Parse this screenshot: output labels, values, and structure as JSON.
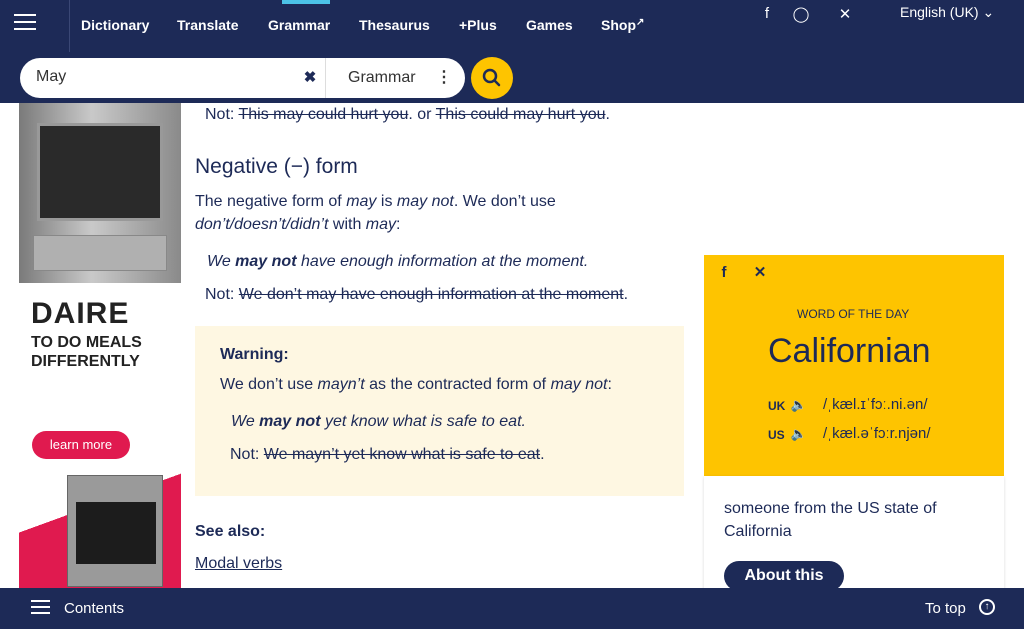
{
  "nav": {
    "items": [
      "Dictionary",
      "Translate",
      "Grammar",
      "Thesaurus",
      "+Plus",
      "Games",
      "Shop"
    ],
    "language": "English (UK)"
  },
  "icons": {
    "menu": "hamburger-menu-icon",
    "shop_external": "external-link-icon",
    "social_top": [
      "facebook-icon",
      "instagram-icon",
      "x-icon"
    ],
    "chevron": "chevron-down-icon",
    "search": "search-icon",
    "clear": "close-icon",
    "options": "vertical-dots-icon",
    "audio": "speaker-icon",
    "to_top": "arrow-up-circle-icon"
  },
  "search": {
    "value": "May",
    "scope": "Grammar"
  },
  "ad": {
    "brand": "DAIRE",
    "tagline": "TO DO MEALS DIFFERENTLY",
    "cta": "learn more"
  },
  "article": {
    "not1_prefix": "Not:",
    "not1_a": "This may could hurt you",
    "not1_mid": ". or",
    "not1_b": "This could may hurt you",
    "not1_end": ".",
    "heading": "Negative (−) form",
    "para1_a": "The negative form of",
    "para1_b": "may",
    "para1_c": "is",
    "para1_d": "may not",
    "para1_e": ". We don’t use",
    "para1_f": "don’t/doesn’t/didn’t",
    "para1_g": "with",
    "para1_h": "may",
    "para1_i": ":",
    "ex1_a": "We",
    "ex1_b": "may not",
    "ex1_c": "have enough information at the moment.",
    "not2_prefix": "Not:",
    "not2_struck": "We don’t may have enough information at the moment",
    "not2_end": ".",
    "warning_title": "Warning:",
    "warning_a": "We don’t use",
    "warning_b": "mayn’t",
    "warning_c": "as the contracted form of",
    "warning_d": "may not",
    "warning_e": ":",
    "ex2_a": "We",
    "ex2_b": "may not",
    "ex2_c": "yet know what is safe to eat.",
    "not3_prefix": "Not:",
    "not3_struck": "We mayn’t yet know what is safe to eat",
    "not3_end": ".",
    "see_also": "See also:",
    "see_link": "Modal verbs"
  },
  "wotd": {
    "label": "WORD OF THE DAY",
    "word": "Californian",
    "uk": "UK",
    "uk_ipa": "/ˌkæl.ɪˈfɔː.ni.ən/",
    "us": "US",
    "us_ipa": "/ˌkæl.əˈfɔːr.njən/",
    "definition": "someone from the US state of California",
    "button": "About this"
  },
  "bottom": {
    "contents": "Contents",
    "to_top": "To top"
  },
  "colors": {
    "navy": "#1d2a57",
    "yellow": "#fec400",
    "warning_bg": "#fef7e2",
    "ad_red": "#e01a4f",
    "accent_blue": "#4cc2e6"
  }
}
